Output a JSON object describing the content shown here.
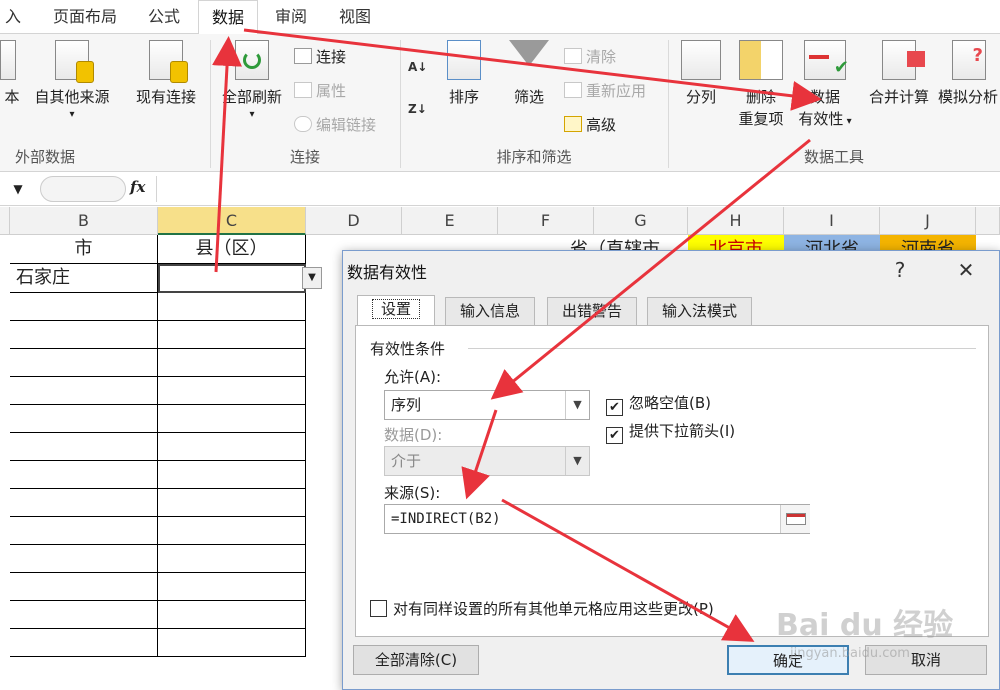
{
  "ribbon_tabs": [
    "入",
    "页面布局",
    "公式",
    "数据",
    "审阅",
    "视图"
  ],
  "ribbon": {
    "from_text_label": "本",
    "other_sources_label": "自其他来源",
    "existing_conn_label": "现有连接",
    "refresh_all_label": "全部刷新",
    "connections_label": "连接",
    "properties_label": "属性",
    "edit_links_label": "编辑链接",
    "sort_label": "排序",
    "filter_label": "筛选",
    "clear_label": "清除",
    "reapply_label": "重新应用",
    "advanced_label": "高级",
    "text_to_columns_label": "分列",
    "remove_dup_label_1": "删除",
    "remove_dup_label_2": "重复项",
    "data_validation_label_1": "数据",
    "data_validation_label_2": "有效性",
    "consolidate_label": "合并计算",
    "what_if_label": "模拟分析",
    "groups": {
      "external": "外部数据",
      "connections": "连接",
      "sort_filter": "排序和筛选",
      "data_tools": "数据工具"
    }
  },
  "formula_bar": {
    "fx_label": "fx",
    "value": ""
  },
  "columns": [
    "B",
    "C",
    "D",
    "E",
    "F",
    "G",
    "H",
    "I",
    "J"
  ],
  "cells": {
    "b1": "市",
    "c1": "县（区）",
    "b2": "石家庄",
    "f1": "省（直辖市",
    "h1": "北京市",
    "i1": "河北省",
    "j1": "河南省"
  },
  "colors": {
    "beijing_fill": "#ffff00",
    "hebei_fill": "#8eb4e3",
    "henan_fill": "#f4b400",
    "arrow": "#e8333c"
  },
  "dialog": {
    "title": "数据有效性",
    "help": "?",
    "close": "✕",
    "tabs": [
      "设置",
      "输入信息",
      "出错警告",
      "输入法模式"
    ],
    "section_title": "有效性条件",
    "allow_label": "允许(A):",
    "allow_value": "序列",
    "data_label": "数据(D):",
    "data_value": "介于",
    "ignore_blank_label": "忽略空值(B)",
    "ignore_blank_checked": true,
    "dropdown_label": "提供下拉箭头(I)",
    "dropdown_checked": true,
    "source_label": "来源(S):",
    "source_value": "=INDIRECT(B2)",
    "apply_all_label": "对有同样设置的所有其他单元格应用这些更改(P)",
    "apply_all_checked": false,
    "clear_all_button": "全部清除(C)",
    "ok_button": "确定",
    "cancel_button": "取消"
  },
  "watermark": "Bai du 经验",
  "watermark_url": "jingyan.baidu.com"
}
